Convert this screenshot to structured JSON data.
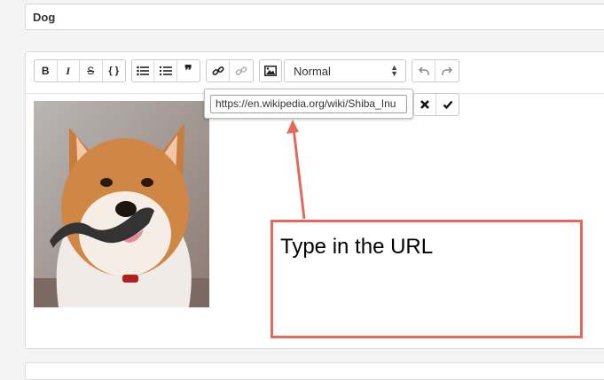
{
  "title_field": {
    "value": "Dog"
  },
  "toolbar": {
    "bold": "B",
    "italic": "I",
    "strike": "S",
    "code": "{ }",
    "quote": "❞",
    "format_select": "Normal"
  },
  "link_popup": {
    "url_value": "https://en.wikipedia.org/wiki/Shiba_Inu"
  },
  "annotation": {
    "text": "Type in the URL",
    "color": "#e26a5b"
  },
  "icons": [
    "unordered-list-icon",
    "ordered-list-icon",
    "link-icon",
    "unlink-icon",
    "image-icon",
    "undo-icon",
    "redo-icon",
    "close-icon",
    "checkmark-icon"
  ]
}
